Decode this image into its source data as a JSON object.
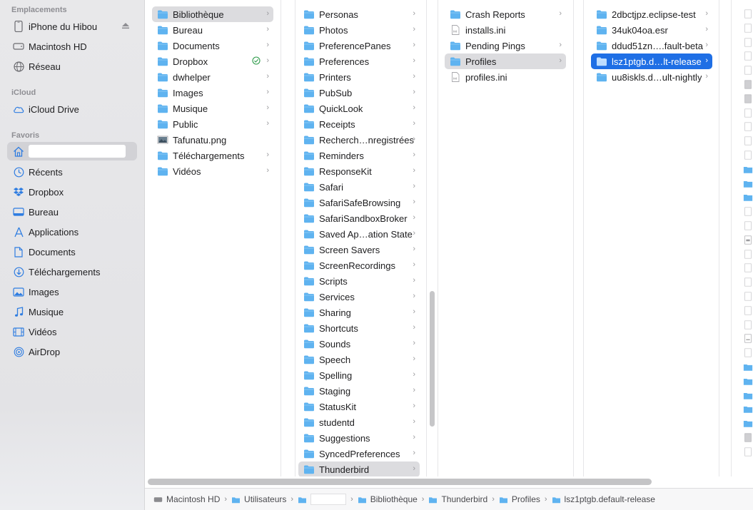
{
  "sidebar": {
    "sections": [
      {
        "label": "Emplacements",
        "items": [
          {
            "label": "iPhone du Hibou",
            "icon": "iphone-icon"
          },
          {
            "label": "Macintosh HD",
            "icon": "disk-icon"
          },
          {
            "label": "Réseau",
            "icon": "globe-icon"
          }
        ]
      },
      {
        "label": "iCloud",
        "items": [
          {
            "label": "iCloud Drive",
            "icon": "cloud-icon"
          }
        ]
      },
      {
        "label": "Favoris",
        "items": [
          {
            "label": "",
            "icon": "home-icon"
          },
          {
            "label": "Récents",
            "icon": "clock-icon"
          },
          {
            "label": "Dropbox",
            "icon": "dropbox-icon"
          },
          {
            "label": "Bureau",
            "icon": "desktop-icon"
          },
          {
            "label": "Applications",
            "icon": "applications-icon"
          },
          {
            "label": "Documents",
            "icon": "document-icon"
          },
          {
            "label": "Téléchargements",
            "icon": "download-icon"
          },
          {
            "label": "Images",
            "icon": "photo-icon"
          },
          {
            "label": "Musique",
            "icon": "music-icon"
          },
          {
            "label": "Vidéos",
            "icon": "film-icon"
          },
          {
            "label": "AirDrop",
            "icon": "airdrop-icon"
          }
        ]
      }
    ]
  },
  "columns": {
    "col1": [
      {
        "name": "Bibliothèque",
        "type": "folder",
        "chevron": true,
        "selected": "grey"
      },
      {
        "name": "Bureau",
        "type": "folder",
        "chevron": true
      },
      {
        "name": "Documents",
        "type": "folder",
        "chevron": true
      },
      {
        "name": "Dropbox",
        "type": "folder",
        "chevron": true,
        "synced": true
      },
      {
        "name": "dwhelper",
        "type": "folder",
        "chevron": true
      },
      {
        "name": "Images",
        "type": "folder",
        "chevron": true
      },
      {
        "name": "Musique",
        "type": "folder",
        "chevron": true
      },
      {
        "name": "Public",
        "type": "folder",
        "chevron": true
      },
      {
        "name": "Tafunatu.png",
        "type": "image"
      },
      {
        "name": "Téléchargements",
        "type": "folder",
        "chevron": true
      },
      {
        "name": "Vidéos",
        "type": "folder",
        "chevron": true
      }
    ],
    "col2": [
      {
        "name": "Personas",
        "type": "folder",
        "chevron": true
      },
      {
        "name": "Photos",
        "type": "folder",
        "chevron": true
      },
      {
        "name": "PreferencePanes",
        "type": "folder",
        "chevron": true
      },
      {
        "name": "Preferences",
        "type": "folder",
        "chevron": true
      },
      {
        "name": "Printers",
        "type": "folder",
        "chevron": true
      },
      {
        "name": "PubSub",
        "type": "folder",
        "chevron": true
      },
      {
        "name": "QuickLook",
        "type": "folder",
        "chevron": true
      },
      {
        "name": "Receipts",
        "type": "folder",
        "chevron": true
      },
      {
        "name": "Recherch…nregistrées",
        "type": "folder",
        "chevron": true
      },
      {
        "name": "Reminders",
        "type": "folder",
        "chevron": true
      },
      {
        "name": "ResponseKit",
        "type": "folder",
        "chevron": true
      },
      {
        "name": "Safari",
        "type": "folder",
        "chevron": true
      },
      {
        "name": "SafariSafeBrowsing",
        "type": "folder",
        "chevron": true
      },
      {
        "name": "SafariSandboxBroker",
        "type": "folder",
        "chevron": true
      },
      {
        "name": "Saved Ap…ation State",
        "type": "folder",
        "chevron": true
      },
      {
        "name": "Screen Savers",
        "type": "folder",
        "chevron": true
      },
      {
        "name": "ScreenRecordings",
        "type": "folder",
        "chevron": true
      },
      {
        "name": "Scripts",
        "type": "folder",
        "chevron": true
      },
      {
        "name": "Services",
        "type": "folder",
        "chevron": true
      },
      {
        "name": "Sharing",
        "type": "folder",
        "chevron": true
      },
      {
        "name": "Shortcuts",
        "type": "folder",
        "chevron": true
      },
      {
        "name": "Sounds",
        "type": "folder",
        "chevron": true
      },
      {
        "name": "Speech",
        "type": "folder",
        "chevron": true
      },
      {
        "name": "Spelling",
        "type": "folder",
        "chevron": true
      },
      {
        "name": "Staging",
        "type": "folder",
        "chevron": true
      },
      {
        "name": "StatusKit",
        "type": "folder",
        "chevron": true
      },
      {
        "name": "studentd",
        "type": "folder",
        "chevron": true
      },
      {
        "name": "Suggestions",
        "type": "folder",
        "chevron": true
      },
      {
        "name": "SyncedPreferences",
        "type": "folder",
        "chevron": true
      },
      {
        "name": "Thunderbird",
        "type": "folder",
        "chevron": true,
        "selected": "grey"
      }
    ],
    "col3": [
      {
        "name": "Crash Reports",
        "type": "folder",
        "chevron": true
      },
      {
        "name": "installs.ini",
        "type": "ini"
      },
      {
        "name": "Pending Pings",
        "type": "folder",
        "chevron": true
      },
      {
        "name": "Profiles",
        "type": "folder",
        "chevron": true,
        "selected": "grey"
      },
      {
        "name": "profiles.ini",
        "type": "ini"
      }
    ],
    "col4": [
      {
        "name": "2dbctjpz.eclipse-test",
        "type": "folder",
        "chevron": true
      },
      {
        "name": "34uk04oa.esr",
        "type": "folder",
        "chevron": true
      },
      {
        "name": "ddud51zn….fault-beta",
        "type": "folder",
        "chevron": true
      },
      {
        "name": "lsz1ptgb.d…lt-release",
        "type": "folder",
        "chevron": true,
        "selected": "blue"
      },
      {
        "name": "uu8iskls.d…ult-nightly",
        "type": "folder",
        "chevron": true
      }
    ]
  },
  "pathbar": [
    {
      "label": "Macintosh HD",
      "icon": "disk-icon"
    },
    {
      "label": "Utilisateurs",
      "icon": "folder-icon"
    },
    {
      "label": "",
      "icon": "home-folder-icon"
    },
    {
      "label": "Bibliothèque",
      "icon": "folder-icon"
    },
    {
      "label": "Thunderbird",
      "icon": "folder-icon"
    },
    {
      "label": "Profiles",
      "icon": "folder-icon"
    },
    {
      "label": "lsz1ptgb.default-release",
      "icon": "folder-icon"
    }
  ],
  "colors": {
    "accent": "#1f6fe5",
    "folder": "#5fb3f0",
    "sync_ok": "#2e9b4a"
  }
}
